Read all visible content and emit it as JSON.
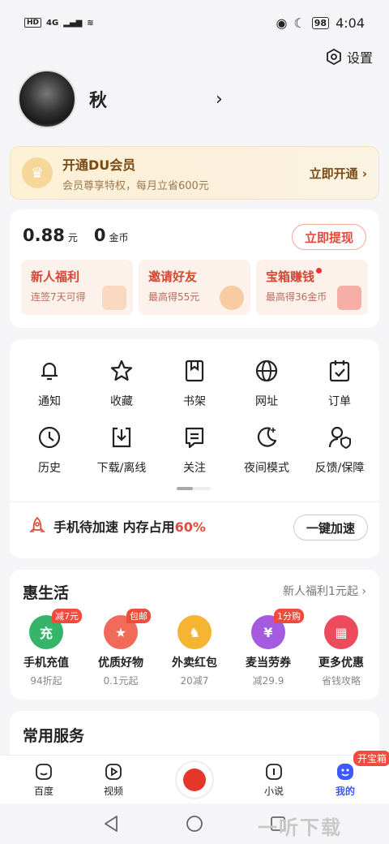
{
  "status_bar": {
    "network_badge": "HD",
    "network": "4G",
    "battery": "98",
    "time": "4:04"
  },
  "header": {
    "settings_label": "设置"
  },
  "profile": {
    "username": "秋"
  },
  "vip": {
    "title": "开通DU会员",
    "subtitle": "会员尊享特权，每月立省600元",
    "action": "立即开通 ›"
  },
  "wallet": {
    "cash_value": "0.88",
    "cash_unit": "元",
    "coin_value": "0",
    "coin_unit": "金币",
    "withdraw_label": "立即提现",
    "promos": [
      {
        "title": "新人福利",
        "subtitle": "连签7天可得"
      },
      {
        "title": "邀请好友",
        "subtitle": "最高得55元"
      },
      {
        "title": "宝箱赚钱",
        "subtitle": "最高得36金币"
      }
    ]
  },
  "tools": {
    "items": [
      {
        "label": "通知",
        "icon": "bell-icon"
      },
      {
        "label": "收藏",
        "icon": "star-icon"
      },
      {
        "label": "书架",
        "icon": "bookmark-icon"
      },
      {
        "label": "网址",
        "icon": "globe-icon"
      },
      {
        "label": "订单",
        "icon": "calendar-check-icon"
      },
      {
        "label": "历史",
        "icon": "clock-icon"
      },
      {
        "label": "下载/离线",
        "icon": "download-icon"
      },
      {
        "label": "关注",
        "icon": "follow-icon"
      },
      {
        "label": "夜间模式",
        "icon": "moon-icon"
      },
      {
        "label": "反馈/保障",
        "icon": "user-shield-icon"
      }
    ],
    "boost_text": "手机待加速 内存占用",
    "boost_percent": "60%",
    "boost_button": "一键加速"
  },
  "life": {
    "title": "惠生活",
    "more": "新人福利1元起 ›",
    "items": [
      {
        "name": "手机充值",
        "desc": "94折起",
        "tag": "减7元",
        "icon_text": "充",
        "color": "#35b46a"
      },
      {
        "name": "优质好物",
        "desc": "0.1元起",
        "tag": "包邮",
        "icon_text": "★",
        "color": "#f26a5a"
      },
      {
        "name": "外卖红包",
        "desc": "20减7",
        "tag": "",
        "icon_text": "♞",
        "color": "#f5b431"
      },
      {
        "name": "麦当劳券",
        "desc": "减29.9",
        "tag": "1分购",
        "icon_text": "¥",
        "color": "#a45be0"
      },
      {
        "name": "更多优惠",
        "desc": "省钱攻略",
        "tag": "",
        "icon_text": "▦",
        "color": "#ee4a5e"
      }
    ]
  },
  "services": {
    "title": "常用服务"
  },
  "tabbar": {
    "tabs": [
      {
        "label": "百度"
      },
      {
        "label": "视频"
      },
      {
        "label": "小说"
      },
      {
        "label": "我的"
      }
    ],
    "badge": "开宝箱"
  },
  "watermark": "一听下载",
  "colors": {
    "accent_red": "#e24a3b",
    "active_blue": "#3d5afe",
    "vip_brown": "#7b4a13"
  }
}
